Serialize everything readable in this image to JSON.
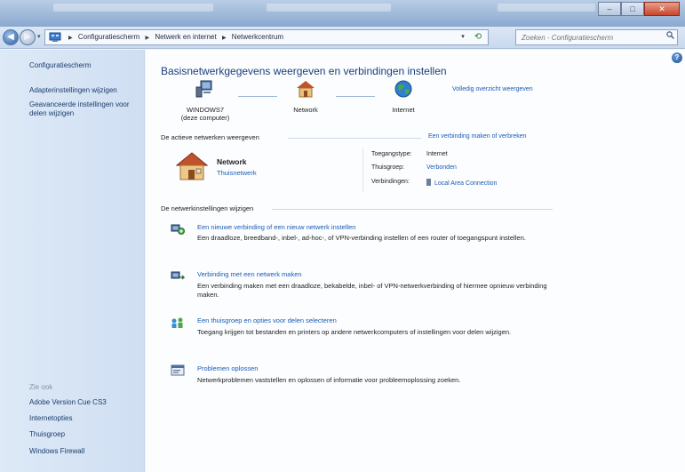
{
  "window": {
    "close_glyph": "✕",
    "min_glyph": "–",
    "max_glyph": "□"
  },
  "nav": {
    "back_glyph": "◀",
    "forward_glyph": "▶",
    "breadcrumbs": [
      "Configuratiescherm",
      "Netwerk en internet",
      "Netwerkcentrum"
    ],
    "search_placeholder": "Zoeken - Configuratiescherm",
    "refresh_icon": "refresh-icon"
  },
  "sidebar": {
    "home": "Configuratiescherm",
    "items": [
      "Adapterinstellingen wijzigen",
      "Geavanceerde instellingen voor delen wijzigen"
    ],
    "see_also_header": "Zie ook",
    "see_also": [
      "Adobe Version Cue CS3",
      "Internetopties",
      "Thuisgroep",
      "Windows Firewall"
    ]
  },
  "main": {
    "title": "Basisnetwerkgegevens weergeven en verbindingen instellen",
    "full_map_link": "Volledig overzicht weergeven",
    "map": {
      "computer_name": "WINDOWS7",
      "computer_sub": "(deze computer)",
      "network": "Network",
      "internet": "Internet"
    },
    "active_header": "De actieve netwerken weergeven",
    "connect_link": "Een verbinding maken of verbreken",
    "active_network": {
      "name": "Network",
      "type": "Thuisnetwerk",
      "access_label": "Toegangstype:",
      "access_value": "Internet",
      "homegroup_label": "Thuisgroep:",
      "homegroup_value": "Verbonden",
      "connections_label": "Verbindingen:",
      "connections_value": "Local Area Connection"
    },
    "change_header": "De netwerkinstellingen wijzigen",
    "tasks": [
      {
        "link": "Een nieuwe verbinding of een nieuw netwerk instellen",
        "desc": "Een draadloze, breedband-, inbel-, ad-hoc-, of VPN-verbinding instellen of een router of toegangspunt instellen."
      },
      {
        "link": "Verbinding met een netwerk maken",
        "desc": "Een verbinding maken met een draadloze, bekabelde, inbel- of VPN-netwerkverbinding of hiermee opnieuw verbinding maken."
      },
      {
        "link": "Een thuisgroep en opties voor delen selecteren",
        "desc": "Toegang krijgen tot bestanden en printers op andere netwerkcomputers of instellingen voor delen wijzigen."
      },
      {
        "link": "Problemen oplossen",
        "desc": "Netwerkproblemen vaststellen en oplossen of informatie voor probleemoplossing zoeken."
      }
    ]
  }
}
